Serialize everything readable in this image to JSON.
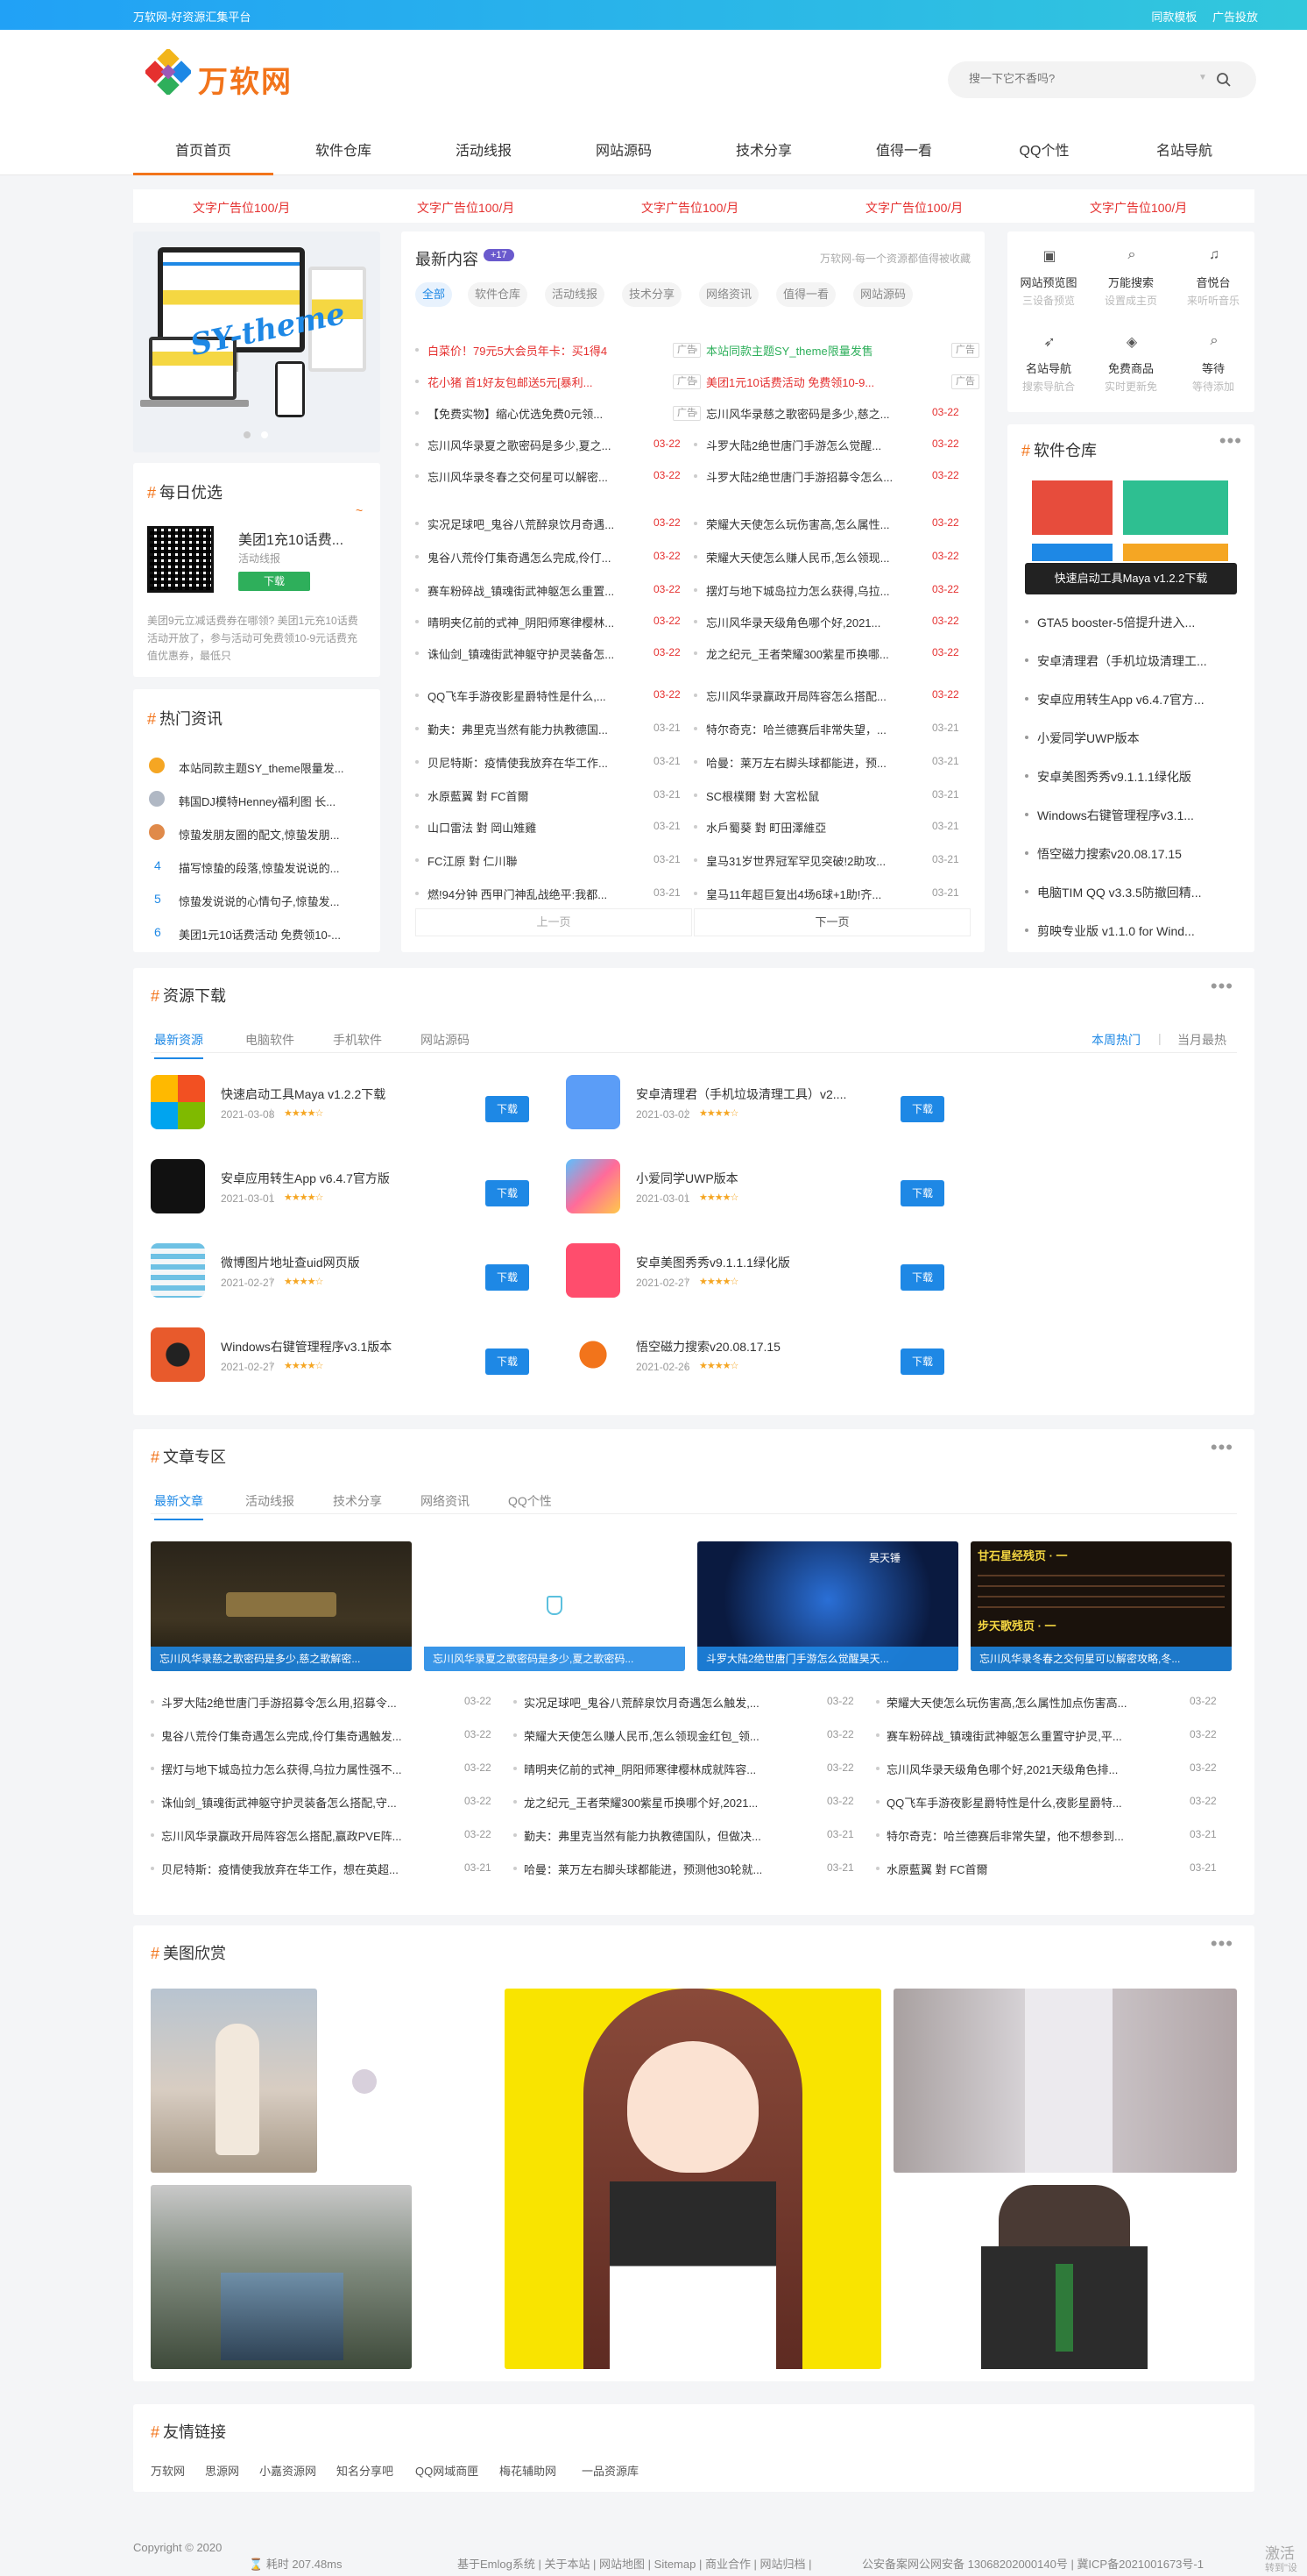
{
  "topbar": {
    "left": "万软网-好资源汇集平台",
    "right": [
      "同款模板",
      "广告投放"
    ]
  },
  "logo": {
    "text": "万软网"
  },
  "search": {
    "placeholder": "搜一下它不香吗?"
  },
  "nav": [
    "首页首页",
    "软件仓库",
    "活动线报",
    "网站源码",
    "技术分享",
    "值得一看",
    "QQ个性",
    "名站导航"
  ],
  "ads": [
    "文字广告位100/月",
    "文字广告位100/月",
    "文字广告位100/月",
    "文字广告位100/月",
    "文字广告位100/月"
  ],
  "banner": {
    "text": "SY-theme"
  },
  "daily": {
    "title": "每日优选",
    "item_title": "美团1充10话费...",
    "item_sub": "活动线报",
    "btn": "下载",
    "desc": "美团9元立减话费券在哪领? 美团1元充10话费活动开放了，参与活动可免费领10-9元话费充值优惠券，最低只"
  },
  "hot": {
    "title": "热门资讯",
    "items": [
      {
        "n": "1",
        "t": "本站同款主题SY_theme限量发..."
      },
      {
        "n": "2",
        "t": "韩国DJ模特Henney福利图 长..."
      },
      {
        "n": "3",
        "t": "惊蛰发朋友圈的配文,惊蛰发朋..."
      },
      {
        "n": "4",
        "t": "描写惊蛰的段落,惊蛰发说说的..."
      },
      {
        "n": "5",
        "t": "惊蛰发说说的心情句子,惊蛰发..."
      },
      {
        "n": "6",
        "t": "美团1元10话费活动 免费领10-..."
      }
    ]
  },
  "latest": {
    "title": "最新内容",
    "badge": "+17",
    "subtitle": "万软网-每一个资源都值得被收藏",
    "tabs": [
      "全部",
      "软件仓库",
      "活动线报",
      "技术分享",
      "网络资讯",
      "值得一看",
      "网站源码"
    ],
    "left": [
      {
        "t": "白菜价！79元5大会员年卡：买1得4",
        "d": "广告",
        "c": "#e5302f"
      },
      {
        "t": "花小猪 首1好友包邮送5元[暴利...",
        "d": "广告",
        "c": "#e5302f"
      },
      {
        "t": "【免费实物】缩心优选免费0元领...",
        "d": "广告",
        "c": "#333"
      },
      {
        "t": "忘川风华录夏之歌密码是多少,夏之...",
        "d": "03-22",
        "c": "#333"
      },
      {
        "t": "忘川风华录冬春之交何星可以解密...",
        "d": "03-22",
        "c": "#333"
      },
      {
        "t": "实况足球吧_鬼谷八荒醉泉饮月奇遇...",
        "d": "03-22",
        "c": "#333"
      },
      {
        "t": "鬼谷八荒伶仃集奇遇怎么完成,伶仃...",
        "d": "03-22",
        "c": "#333"
      },
      {
        "t": "赛车粉碎战_镇魂街武神躯怎么重置...",
        "d": "03-22",
        "c": "#333"
      },
      {
        "t": "晴明夹亿前的式神_阴阳师寒律樱林...",
        "d": "03-22",
        "c": "#333"
      },
      {
        "t": "诛仙剑_镇魂街武神躯守护灵装备怎...",
        "d": "03-22",
        "c": "#333"
      },
      {
        "t": "QQ飞车手游夜影星爵特性是什么,...",
        "d": "03-22",
        "c": "#333"
      },
      {
        "t": "勤夫：弗里克当然有能力执教德国...",
        "d": "03-21",
        "c": "#333"
      },
      {
        "t": "贝尼特斯：疫情使我放弃在华工作...",
        "d": "03-21",
        "c": "#333"
      },
      {
        "t": "水原藍翼 對 FC首爾",
        "d": "03-21",
        "c": "#333"
      },
      {
        "t": "山口雷法 對 岡山雉雞",
        "d": "03-21",
        "c": "#333"
      },
      {
        "t": "FC江原 對 仁川聯",
        "d": "03-21",
        "c": "#333"
      },
      {
        "t": "燃!94分钟 西甲门神乱战绝平:我都...",
        "d": "03-21",
        "c": "#333"
      }
    ],
    "right": [
      {
        "t": "本站同款主题SY_theme限量发售",
        "d": "广告",
        "c": "#2eaf5b"
      },
      {
        "t": "美团1元10话费活动 免费领10-9...",
        "d": "广告",
        "c": "#e5302f"
      },
      {
        "t": "忘川风华录慈之歌密码是多少,慈之...",
        "d": "03-22",
        "c": "#333"
      },
      {
        "t": "斗罗大陆2绝世唐门手游怎么觉醒...",
        "d": "03-22",
        "c": "#333"
      },
      {
        "t": "斗罗大陆2绝世唐门手游招募令怎么...",
        "d": "03-22",
        "c": "#333"
      },
      {
        "t": "荣耀大天使怎么玩伤害高,怎么属性...",
        "d": "03-22",
        "c": "#333"
      },
      {
        "t": "荣耀大天使怎么赚人民币,怎么领现...",
        "d": "03-22",
        "c": "#333"
      },
      {
        "t": "摆灯与地下城岛拉力怎么获得,乌拉...",
        "d": "03-22",
        "c": "#333"
      },
      {
        "t": "忘川风华录天级角色哪个好,2021...",
        "d": "03-22",
        "c": "#333"
      },
      {
        "t": "龙之纪元_王者荣耀300紫星币换哪...",
        "d": "03-22",
        "c": "#333"
      },
      {
        "t": "忘川风华录赢政开局阵容怎么搭配...",
        "d": "03-22",
        "c": "#333"
      },
      {
        "t": "特尔奇克：哈兰德赛后非常失望，...",
        "d": "03-21",
        "c": "#333"
      },
      {
        "t": "哈曼：莱万左右脚头球都能进，预...",
        "d": "03-21",
        "c": "#333"
      },
      {
        "t": "SC根樸爾 對 大宮松鼠",
        "d": "03-21",
        "c": "#333"
      },
      {
        "t": "水戶蜀葵 對 町田澤維亞",
        "d": "03-21",
        "c": "#333"
      },
      {
        "t": "皇马31岁世界冠军罕见突破!2助攻...",
        "d": "03-21",
        "c": "#333"
      },
      {
        "t": "皇马11年超巨复出4场6球+1助!齐...",
        "d": "03-21",
        "c": "#333"
      }
    ],
    "prev": "上一页",
    "next": "下一页"
  },
  "quick": [
    {
      "t": "网站预览图",
      "s": "三设备预览"
    },
    {
      "t": "万能搜索",
      "s": "设置成主页"
    },
    {
      "t": "音悦台",
      "s": "来听听音乐"
    },
    {
      "t": "名站导航",
      "s": "搜索导航合"
    },
    {
      "t": "免费商品",
      "s": "实时更新免"
    },
    {
      "t": "等待",
      "s": "等待添加"
    }
  ],
  "softlib": {
    "title": "软件仓库",
    "overlay": "快速启动工具Maya v1.2.2下载",
    "items": [
      "GTA5 booster-5倍提升进入...",
      "安卓清理君（手机垃圾清理工...",
      "安卓应用转生App v6.4.7官方...",
      "小爱同学UWP版本",
      "安卓美图秀秀v9.1.1.1绿化版",
      "Windows右键管理程序v3.1...",
      "悟空磁力搜索v20.08.17.15",
      "电脑TIM QQ v3.3.5防撤回精...",
      "剪映专业版 v1.1.0 for Wind..."
    ]
  },
  "resources": {
    "title": "资源下载",
    "tabs": [
      "最新资源",
      "电脑软件",
      "手机软件",
      "网站源码"
    ],
    "rtabs": [
      "本周热门",
      "当月最热"
    ],
    "items": [
      {
        "t": "快速启动工具Maya v1.2.2下载",
        "d": "2021-03-08",
        "v": "1"
      },
      {
        "t": "安卓清理君（手机垃圾清理工具）v2....",
        "d": "2021-03-02",
        "v": "1"
      },
      {
        "t": "安卓应用转生App v6.4.7官方版",
        "d": "2021-03-01",
        "v": "1"
      },
      {
        "t": "小爱同学UWP版本",
        "d": "2021-03-01",
        "v": "1"
      },
      {
        "t": "微博图片地址查uid网页版",
        "d": "2021-02-27",
        "v": "1"
      },
      {
        "t": "安卓美图秀秀v9.1.1.1绿化版",
        "d": "2021-02-27",
        "v": "1"
      },
      {
        "t": "Windows右键管理程序v3.1版本",
        "d": "2021-02-27",
        "v": "1"
      },
      {
        "t": "悟空磁力搜索v20.08.17.15",
        "d": "2021-02-26",
        "v": "1"
      }
    ],
    "btn": "下载",
    "stars": "★★★★☆"
  },
  "articles": {
    "title": "文章专区",
    "tabs": [
      "最新文章",
      "活动线报",
      "技术分享",
      "网络资讯",
      "QQ个性"
    ],
    "thumbs": [
      "忘川风华录慈之歌密码是多少,慈之歌解密...",
      "忘川风华录夏之歌密码是多少,夏之歌密码...",
      "斗罗大陆2绝世唐门手游怎么觉醒昊天...",
      "忘川风华录冬春之交何星可以解密攻略,冬..."
    ],
    "thumb_texts": [
      "甘石星经残页 · 一",
      "步天歌残页 · 一",
      "昊天锤"
    ],
    "cols": [
      [
        {
          "t": "斗罗大陆2绝世唐门手游招募令怎么用,招募令...",
          "d": "03-22"
        },
        {
          "t": "鬼谷八荒伶仃集奇遇怎么完成,伶仃集奇遇触发...",
          "d": "03-22"
        },
        {
          "t": "摆灯与地下城岛拉力怎么获得,乌拉力属性强不...",
          "d": "03-22"
        },
        {
          "t": "诛仙剑_镇魂街武神躯守护灵装备怎么搭配,守...",
          "d": "03-22"
        },
        {
          "t": "忘川风华录赢政开局阵容怎么搭配,赢政PVE阵...",
          "d": "03-22"
        },
        {
          "t": "贝尼特斯：疫情使我放弃在华工作，想在英超...",
          "d": "03-21"
        }
      ],
      [
        {
          "t": "实况足球吧_鬼谷八荒醉泉饮月奇遇怎么触发,...",
          "d": "03-22"
        },
        {
          "t": "荣耀大天使怎么赚人民币,怎么领现金红包_领...",
          "d": "03-22"
        },
        {
          "t": "晴明夹亿前的式神_阴阳师寒律樱林成就阵容...",
          "d": "03-22"
        },
        {
          "t": "龙之纪元_王者荣耀300紫星币换哪个好,2021...",
          "d": "03-22"
        },
        {
          "t": "勤夫：弗里克当然有能力执教德国队，但做决...",
          "d": "03-21"
        },
        {
          "t": "哈曼：莱万左右脚头球都能进，预测他30轮就...",
          "d": "03-21"
        }
      ],
      [
        {
          "t": "荣耀大天使怎么玩伤害高,怎么属性加点伤害高...",
          "d": "03-22"
        },
        {
          "t": "赛车粉碎战_镇魂街武神躯怎么重置守护灵,平...",
          "d": "03-22"
        },
        {
          "t": "忘川风华录天级角色哪个好,2021天级角色排...",
          "d": "03-22"
        },
        {
          "t": "QQ飞车手游夜影星爵特性是什么,夜影星爵特...",
          "d": "03-22"
        },
        {
          "t": "特尔奇克：哈兰德赛后非常失望，他不想参到...",
          "d": "03-21"
        },
        {
          "t": "水原藍翼 對 FC首爾",
          "d": "03-21"
        }
      ]
    ]
  },
  "gallery": {
    "title": "美图欣赏"
  },
  "links": {
    "title": "友情链接",
    "items": [
      "万软网",
      "思源网",
      "小嘉资源网",
      "知名分享吧",
      "QQ网域商匣",
      "梅花辅助网",
      "一品资源库"
    ]
  },
  "footer": {
    "copy": "Copyright © 2020",
    "time": "耗时 207.48ms",
    "links": "基于Emlog系统 | 关于本站 | 网站地图 | Sitemap | 商业合作 | 网站归档 |",
    "icp": "公安备案网公网安备 13068202000140号 | 冀ICP备2021001673号-1",
    "watermark": "激活",
    "watermark2": "转到\"设"
  },
  "colors": {
    "accent": "#f2741b",
    "blue": "#1e88e5",
    "red": "#e5302f"
  }
}
